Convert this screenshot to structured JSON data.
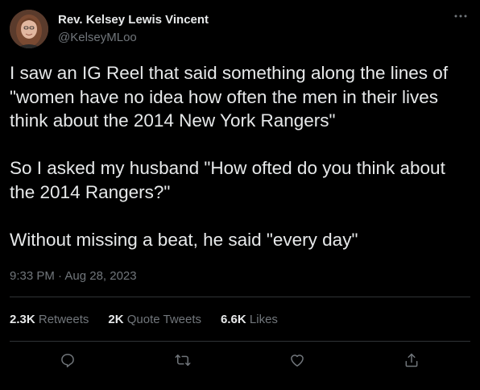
{
  "author": {
    "display_name": "Rev. Kelsey Lewis Vincent",
    "handle": "@KelseyMLoo"
  },
  "tweet": {
    "paragraphs": [
      "I saw an IG Reel that said something along the lines of \"women have no idea how often the men in their lives think about the 2014 New York Rangers\"",
      "So I asked my husband \"How ofted do you think about the 2014 Rangers?\"",
      "Without missing a beat, he said \"every day\""
    ],
    "timestamp": "9:33 PM · Aug 28, 2023"
  },
  "stats": {
    "retweets": {
      "count": "2.3K",
      "label": "Retweets"
    },
    "quote_tweets": {
      "count": "2K",
      "label": "Quote Tweets"
    },
    "likes": {
      "count": "6.6K",
      "label": "Likes"
    }
  },
  "icons": {
    "more": "more-horizontal-icon",
    "reply": "reply-icon",
    "retweet": "retweet-icon",
    "like": "heart-icon",
    "share": "share-icon"
  },
  "colors": {
    "background": "#000000",
    "primary_text": "#e7e9ea",
    "secondary_text": "#71767b",
    "divider": "#2f3336"
  }
}
